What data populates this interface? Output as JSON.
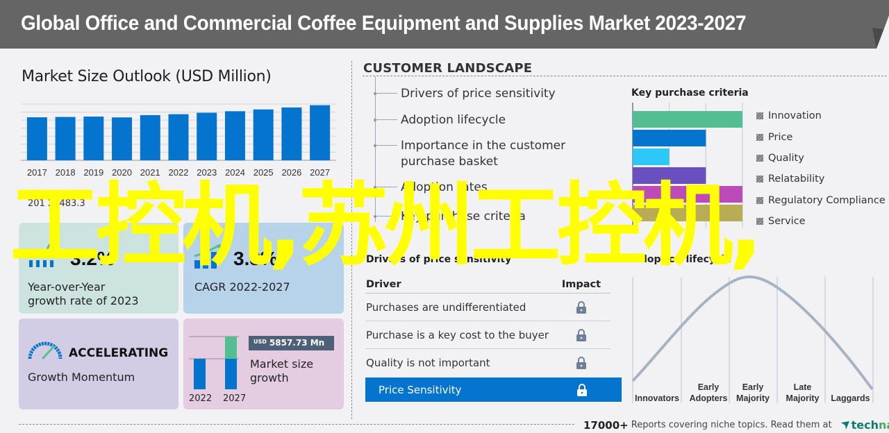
{
  "header": {
    "title": "Global Office and Commercial Coffee Equipment and Supplies Market 2023-2027"
  },
  "market_size": {
    "title": "Market Size Outlook (USD Million)",
    "caption_fragment": "201  20483.3"
  },
  "chart_data": {
    "type": "bar",
    "title": "Market Size Outlook (USD Million)",
    "categories": [
      "2017",
      "2018",
      "2019",
      "2020",
      "2021",
      "2022",
      "2023",
      "2024",
      "2025",
      "2026",
      "2027"
    ],
    "values": [
      0.765,
      0.771,
      0.778,
      0.763,
      0.804,
      0.82,
      0.846,
      0.873,
      0.905,
      0.94,
      0.98
    ],
    "value_units": "relative to axis max (unlabeled axis)",
    "xlabel": "",
    "ylabel": "",
    "ylim": [
      0,
      1
    ],
    "grid": true,
    "color": "#0474cf"
  },
  "cards": {
    "yoy": {
      "value": "3.2%",
      "label_line1": "Year-over-Year",
      "label_line2": "growth rate of 2023"
    },
    "cagr": {
      "value": "3.8%",
      "label": "CAGR  2022-2027"
    },
    "momentum": {
      "value": "ACCELERATING",
      "label": "Growth Momentum"
    },
    "market_growth": {
      "badge_prefix": "USD",
      "badge_value": "5857.73 Mn",
      "label_line1": "Market size",
      "label_line2": "growth",
      "year_start": "2022",
      "year_end": "2027"
    }
  },
  "customer_landscape": {
    "title": "CUSTOMER  LANDSCAPE",
    "items": [
      {
        "label": "Drivers of price sensitivity"
      },
      {
        "label": "Adoption lifecycle"
      },
      {
        "label": "Importance in the customer",
        "label2": "purchase basket"
      },
      {
        "label": "Adoption rates"
      },
      {
        "label": "Key purchase criteria"
      }
    ]
  },
  "key_purchase_criteria": {
    "title": "Key purchase criteria",
    "items": [
      {
        "label": "Innovation",
        "value": 3,
        "color": "#52be92"
      },
      {
        "label": "Price",
        "value": 2,
        "color": "#0474cf"
      },
      {
        "label": "Quality",
        "value": 1,
        "color": "#2ec8f8"
      },
      {
        "label": "Relatability",
        "value": 2,
        "color": "#6a4fc0"
      },
      {
        "label": "Regulatory Compliance",
        "value": 3,
        "color": "#bd4bb7"
      },
      {
        "label": "Service",
        "value": 3,
        "color": "#b8ad55"
      }
    ],
    "max": 3
  },
  "drivers": {
    "title": "Drivers of price sensitivity",
    "col_driver": "Driver",
    "col_impact": "Impact",
    "rows": [
      {
        "label": "Purchases are undifferentiated",
        "icon": "lock-icon"
      },
      {
        "label": "Purchase is a key cost to the buyer",
        "icon": "lock-icon"
      },
      {
        "label": "Quality is not important",
        "icon": "lock-icon"
      }
    ],
    "highlight": {
      "label": "Price Sensitivity",
      "icon": "lock-icon"
    }
  },
  "adoption_lifecycle": {
    "title": "Adoption lifecycle",
    "stages": [
      {
        "line1": "",
        "line2": "Innovators"
      },
      {
        "line1": "Early",
        "line2": "Adopters"
      },
      {
        "line1": "Early",
        "line2": "Majority"
      },
      {
        "line1": "Late",
        "line2": "Majority"
      },
      {
        "line1": "",
        "line2": "Laggards"
      }
    ]
  },
  "footer": {
    "count": "17000+",
    "text": "Reports covering niche topics. Read them at",
    "brand_a": "tech",
    "brand_b": "navio"
  },
  "watermark": {
    "text": "工控机,苏州工控机,"
  },
  "colors": {
    "banner": "#656565",
    "accent_blue": "#0474cf",
    "accent_green": "#52be92",
    "watermark": "#ffff00"
  }
}
